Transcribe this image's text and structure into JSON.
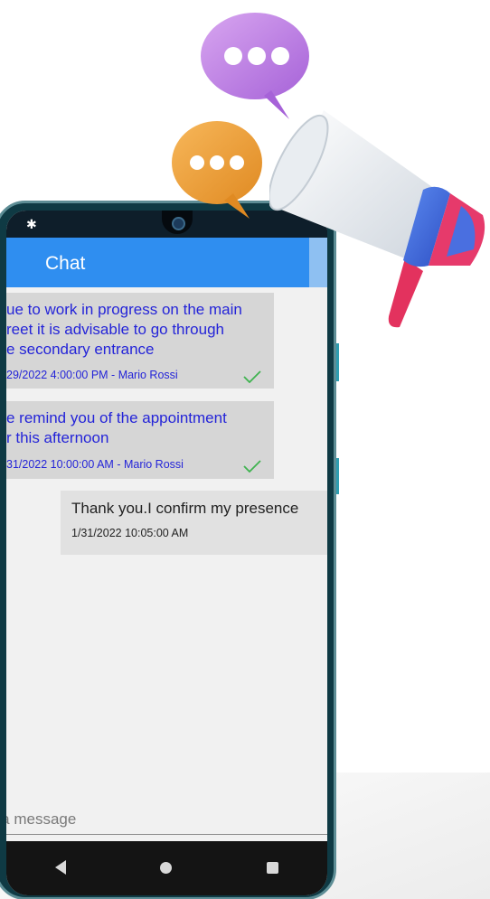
{
  "app": {
    "title": "Chat"
  },
  "messages_in": [
    {
      "lines": "ue to work in progress on the main\nreet it is advisable to go through\ne secondary entrance",
      "meta": "29/2022 4:00:00 PM - Mario Rossi"
    },
    {
      "lines": "e remind you of the appointment\nr this afternoon",
      "meta": "31/2022 10:00:00 AM - Mario Rossi"
    }
  ],
  "message_out": {
    "text": "Thank you.I confirm my presence",
    "meta": "1/31/2022 10:05:00 AM"
  },
  "composer": {
    "placeholder": "e a message"
  },
  "colors": {
    "appbar": "#2f8ef0",
    "incoming_text": "#2424d8",
    "check": "#3fb34f"
  },
  "icons": [
    "settings-icon",
    "checkmark-icon",
    "back-icon",
    "home-icon",
    "recent-apps-icon",
    "chat-bubble-icon",
    "megaphone-icon"
  ]
}
